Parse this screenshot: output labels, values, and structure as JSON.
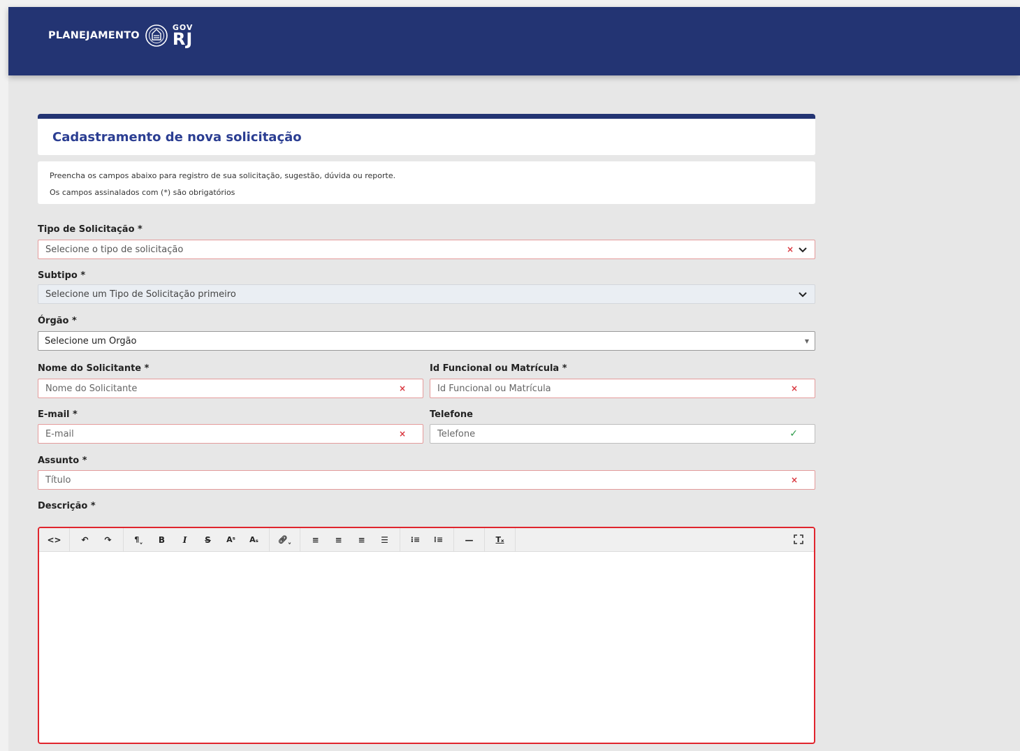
{
  "header": {
    "brand_text": "PLANEJAMENTO",
    "gov_top": "GOV",
    "gov_bottom": "RJ"
  },
  "page": {
    "title": "Cadastramento de nova solicitação",
    "info_line1": "Preencha os campos abaixo para registro de sua solicitação, sugestão, dúvida ou reporte.",
    "info_line2": "Os campos assinalados com (*) são obrigatórios"
  },
  "form": {
    "tipo": {
      "label": "Tipo de Solicitação *",
      "value": "Selecione o tipo de solicitação"
    },
    "subtipo": {
      "label": "Subtipo *",
      "value": "Selecione um Tipo de Solicitação primeiro"
    },
    "orgao": {
      "label": "Órgão *",
      "value": "Selecione um Órgão"
    },
    "nome": {
      "label": "Nome do Solicitante *",
      "placeholder": "Nome do Solicitante"
    },
    "idfuncional": {
      "label": "Id Funcional ou Matrícula *",
      "placeholder": "Id Funcional ou Matrícula"
    },
    "email": {
      "label": "E-mail *",
      "placeholder": "E-mail"
    },
    "telefone": {
      "label": "Telefone",
      "placeholder": "Telefone"
    },
    "assunto": {
      "label": "Assunto *",
      "placeholder": "Título"
    },
    "descricao": {
      "label": "Descrição *"
    }
  },
  "icons": {
    "invalid": "×",
    "valid": "✓"
  },
  "colors": {
    "header_bg": "#233473",
    "title": "#2b3e92",
    "invalid_border": "#e49b9b",
    "editor_border": "#e0252d",
    "valid": "#2e9b4a"
  }
}
